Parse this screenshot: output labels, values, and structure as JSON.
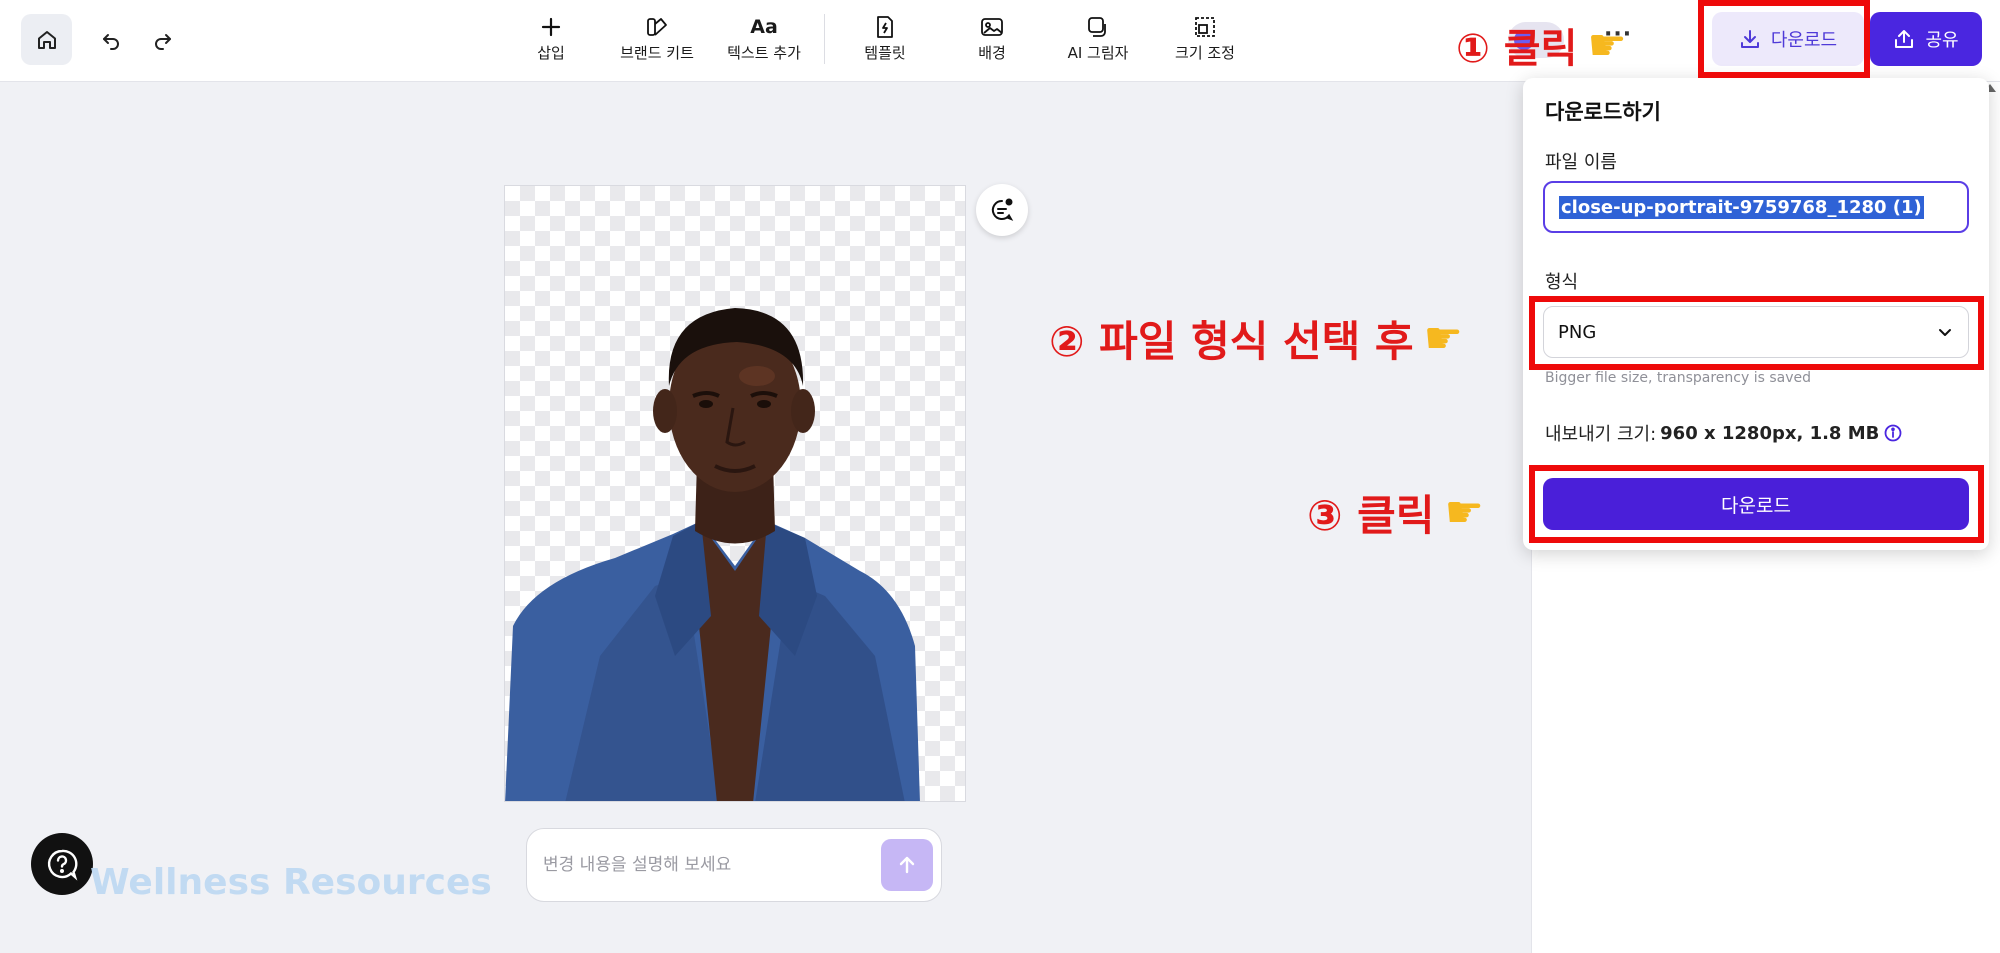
{
  "toolbar": {
    "tools": [
      {
        "label": "삽입"
      },
      {
        "label": "브랜드 키트"
      },
      {
        "label": "텍스트 추가",
        "glyph": "Aa"
      },
      {
        "label": "템플릿"
      },
      {
        "label": "배경"
      },
      {
        "label": "AI 그림자"
      },
      {
        "label": "크기 조정"
      }
    ],
    "more": "···",
    "download_label": "다운로드",
    "share_label": "공유"
  },
  "prompt": {
    "placeholder": "변경 내용을 설명해 보세요"
  },
  "watermark": "Wellness Resources",
  "download_panel": {
    "title": "다운로드하기",
    "filename_label": "파일 이름",
    "filename_value": "close-up-portrait-9759768_1280 (1)",
    "format_label": "형식",
    "format_value": "PNG",
    "format_hint": "Bigger file size, transparency is saved",
    "export_size_label": "내보내기 크기:",
    "export_size_value": "960 x 1280px, 1.8 MB",
    "action_label": "다운로드"
  },
  "annotations": {
    "step1": "① 클릭",
    "step2": "② 파일 형식 선택 후",
    "step3": "③ 클릭",
    "hand_icon": "pointing-hand"
  },
  "colors": {
    "accent": "#4a26e0",
    "annotation_red": "#ee0a0a"
  }
}
